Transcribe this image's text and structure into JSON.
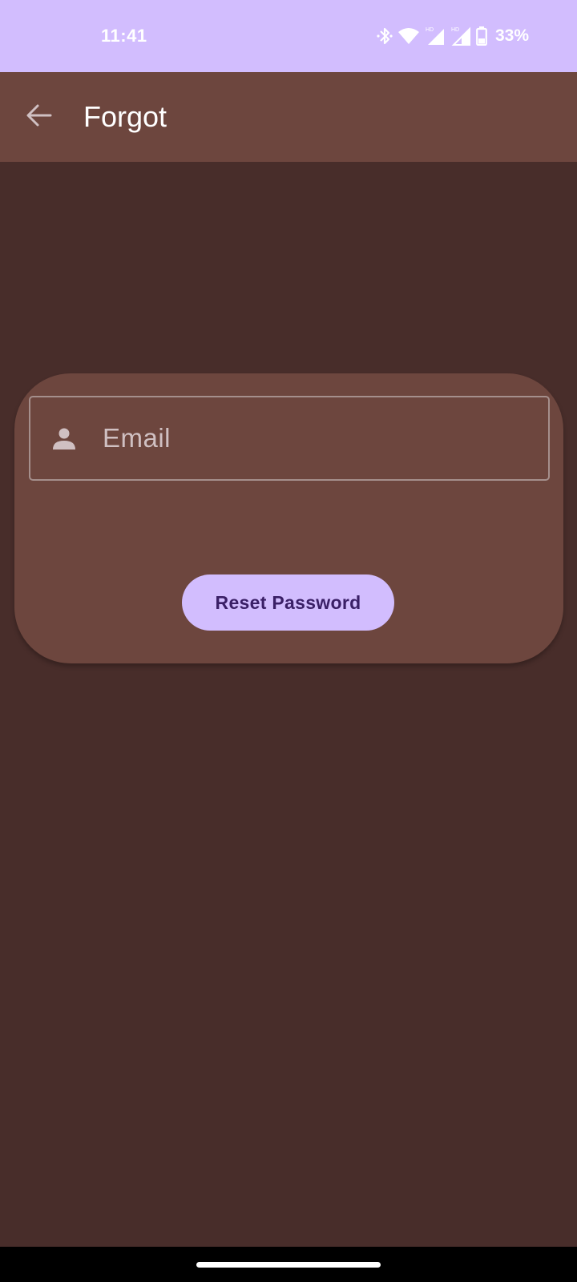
{
  "colors": {
    "status_bar_bg": "#d2bdfe",
    "app_bar_bg": "#6d463e",
    "page_bg": "#482d2a",
    "card_bg": "#6d463e",
    "button_bg": "#d2bdfe",
    "button_text": "#3a1f66",
    "icon_tint": "#d0c0c2",
    "nav_bar_bg": "#000000"
  },
  "status_bar": {
    "time": "11:41",
    "icons": [
      "bluetooth-icon",
      "wifi-icon",
      "signal-hd-icon",
      "signal-hd-icon",
      "battery-icon"
    ],
    "battery": "33%"
  },
  "app_bar": {
    "back_icon": "arrow-back-icon",
    "title": "Forgot"
  },
  "form": {
    "email_icon": "person-icon",
    "email_placeholder": "Email",
    "email_value": "",
    "reset_button_label": "Reset Password"
  }
}
